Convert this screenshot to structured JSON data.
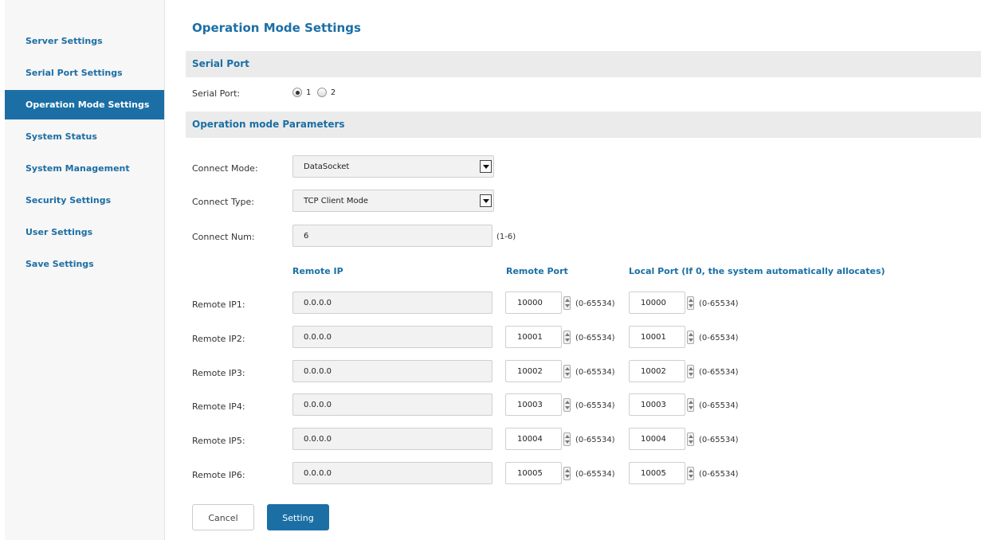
{
  "sidebar": {
    "items": [
      {
        "label": "Server Settings",
        "active": false
      },
      {
        "label": "Serial Port Settings",
        "active": false
      },
      {
        "label": "Operation Mode Settings",
        "active": true
      },
      {
        "label": "System Status",
        "active": false
      },
      {
        "label": "System Management",
        "active": false
      },
      {
        "label": "Security Settings",
        "active": false
      },
      {
        "label": "User Settings",
        "active": false
      },
      {
        "label": "Save Settings",
        "active": false
      }
    ]
  },
  "page": {
    "title": "Operation Mode Settings"
  },
  "serial_section": {
    "heading": "Serial Port",
    "label": "Serial Port:",
    "options": [
      {
        "label": "1",
        "checked": true
      },
      {
        "label": "2",
        "checked": false
      }
    ]
  },
  "params_section": {
    "heading": "Operation mode Parameters",
    "connect_mode_label": "Connect Mode:",
    "connect_mode_value": "DataSocket",
    "connect_type_label": "Connect Type:",
    "connect_type_value": "TCP Client Mode",
    "connect_num_label": "Connect Num:",
    "connect_num_value": "6",
    "connect_num_hint": "(1-6)"
  },
  "table": {
    "headers": {
      "remote_ip": "Remote IP",
      "remote_port": "Remote Port",
      "local_port": "Local Port (If 0, the system automatically allocates)"
    },
    "range_hint": "(0-65534)",
    "rows": [
      {
        "label": "Remote IP1:",
        "ip": "0.0.0.0",
        "remote_port": "10000",
        "local_port": "10000"
      },
      {
        "label": "Remote IP2:",
        "ip": "0.0.0.0",
        "remote_port": "10001",
        "local_port": "10001"
      },
      {
        "label": "Remote IP3:",
        "ip": "0.0.0.0",
        "remote_port": "10002",
        "local_port": "10002"
      },
      {
        "label": "Remote IP4:",
        "ip": "0.0.0.0",
        "remote_port": "10003",
        "local_port": "10003"
      },
      {
        "label": "Remote IP5:",
        "ip": "0.0.0.0",
        "remote_port": "10004",
        "local_port": "10004"
      },
      {
        "label": "Remote IP6:",
        "ip": "0.0.0.0",
        "remote_port": "10005",
        "local_port": "10005"
      }
    ]
  },
  "buttons": {
    "cancel": "Cancel",
    "setting": "Setting"
  },
  "colors": {
    "accent": "#1b6fa5",
    "section_bg": "#ebebeb",
    "sidebar_bg": "#f7f7f7"
  }
}
